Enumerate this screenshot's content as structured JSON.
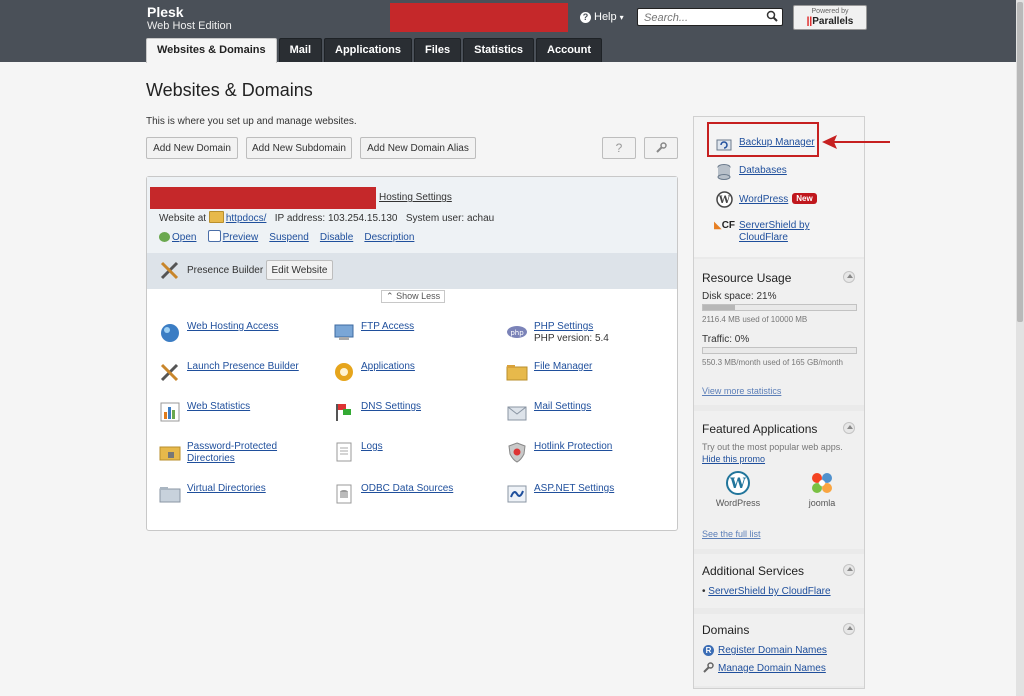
{
  "header": {
    "brand": "Plesk",
    "edition": "Web Host Edition",
    "help_label": "Help",
    "search_placeholder": "Search...",
    "powered_by": "Powered by",
    "vendor": "Parallels",
    "tabs": [
      {
        "label": "Websites & Domains",
        "active": true
      },
      {
        "label": "Mail"
      },
      {
        "label": "Applications"
      },
      {
        "label": "Files"
      },
      {
        "label": "Statistics"
      },
      {
        "label": "Account"
      }
    ]
  },
  "main": {
    "title": "Websites & Domains",
    "description": "This is where you set up and manage websites.",
    "buttons": {
      "add_domain": "Add New Domain",
      "add_subdomain": "Add New Subdomain",
      "add_alias": "Add New Domain Alias",
      "help": "?"
    },
    "domain": {
      "hosting_settings": "Hosting Settings",
      "website_at": "Website at",
      "docroot": "httpdocs/",
      "ip": "IP address: 103.254.15.130",
      "system_user": "System user: achau",
      "actions": {
        "open": "Open",
        "preview": "Preview",
        "suspend": "Suspend",
        "disable": "Disable",
        "description": "Description"
      },
      "presence_builder": "Presence Builder",
      "edit_website": "Edit Website",
      "show_less": "Show Less"
    },
    "tools": {
      "web_hosting_access": "Web Hosting Access",
      "ftp_access": "FTP Access",
      "php_settings": "PHP Settings",
      "php_version": "PHP version: 5.4",
      "launch_presence_builder": "Launch Presence Builder",
      "applications": "Applications",
      "file_manager": "File Manager",
      "web_statistics": "Web Statistics",
      "dns_settings": "DNS Settings",
      "mail_settings": "Mail Settings",
      "password_protected_1": "Password-Protected",
      "password_protected_2": "Directories",
      "logs": "Logs",
      "hotlink_protection": "Hotlink Protection",
      "virtual_directories": "Virtual Directories",
      "odbc_data_sources": "ODBC Data Sources",
      "aspnet_settings": "ASP.NET Settings"
    }
  },
  "sidebar": {
    "quick_links": {
      "backup_manager": "Backup Manager",
      "databases": "Databases",
      "wordpress": "WordPress",
      "new_badge": "New",
      "servershield_1": "ServerShield by",
      "servershield_2": "CloudFlare"
    },
    "resource_usage": {
      "title": "Resource Usage",
      "disk_label": "Disk space: 21%",
      "disk_percent": 21,
      "disk_detail": "2116.4 MB used of 10000 MB",
      "traffic_label": "Traffic: 0%",
      "traffic_percent": 0,
      "traffic_detail": "550.3 MB/month used of 165 GB/month",
      "more": "View more statistics"
    },
    "featured_apps": {
      "title": "Featured Applications",
      "desc": "Try out the most popular web apps.",
      "hide": "Hide this promo",
      "app1": "WordPress",
      "app2": "joomla",
      "full_list": "See the full list"
    },
    "additional_services": {
      "title": "Additional Services",
      "item1": "ServerShield by CloudFlare"
    },
    "domains": {
      "title": "Domains",
      "register": "Register Domain Names",
      "manage": "Manage Domain Names"
    }
  },
  "colors": {
    "header_bg": "#4a5058",
    "tab_bg": "#2a2e33",
    "link": "#1f4f9c",
    "highlight": "#c62020",
    "new_badge": "#c0171d"
  }
}
